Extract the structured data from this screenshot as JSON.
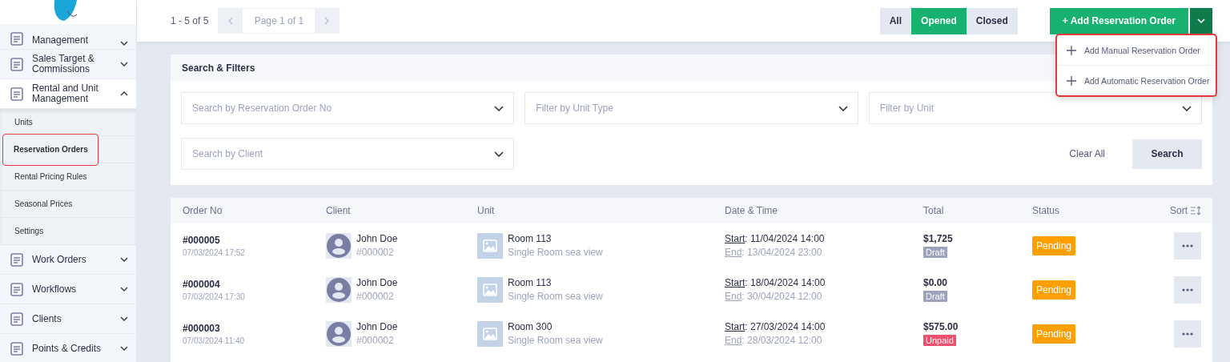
{
  "sidebar": {
    "items": [
      {
        "label": "Management",
        "expanded": false
      },
      {
        "label": "Sales Target & Commissions",
        "expanded": false
      },
      {
        "label": "Rental and Unit Management",
        "expanded": true,
        "children": [
          {
            "label": "Units",
            "selected": false,
            "highlighted": false
          },
          {
            "label": "Reservation Orders",
            "selected": true,
            "highlighted": true
          },
          {
            "label": "Rental Pricing Rules",
            "selected": false,
            "highlighted": false
          },
          {
            "label": "Seasonal Prices",
            "selected": false,
            "highlighted": false
          },
          {
            "label": "Settings",
            "selected": false,
            "highlighted": false
          }
        ]
      },
      {
        "label": "Work Orders",
        "expanded": false
      },
      {
        "label": "Workflows",
        "expanded": false
      },
      {
        "label": "Clients",
        "expanded": false
      },
      {
        "label": "Points & Credits",
        "expanded": false
      }
    ]
  },
  "toolbar": {
    "count": "1 - 5 of 5",
    "page": "Page 1 of 1",
    "filters": [
      {
        "label": "All",
        "selected": false
      },
      {
        "label": "Opened",
        "selected": true
      },
      {
        "label": "Closed",
        "selected": false
      }
    ],
    "add_button": "+ Add Reservation Order",
    "add_menu": {
      "open": true,
      "highlighted": true,
      "items": [
        "Add Manual Reservation Order",
        "Add Automatic Reservation Order"
      ]
    }
  },
  "filters": {
    "title": "Search & Filters",
    "fields": [
      {
        "placeholder": "Search by Reservation Order No"
      },
      {
        "placeholder": "Filter by Unit Type"
      },
      {
        "placeholder": "Filter by Unit"
      },
      {
        "placeholder": "Search by Client"
      }
    ],
    "clear": "Clear All",
    "search": "Search"
  },
  "table": {
    "columns": [
      "Order No",
      "Client",
      "Unit",
      "Date & Time",
      "Total",
      "Status",
      "Sort"
    ],
    "rows": [
      {
        "order": "#000005",
        "created": "07/03/2024 17:52",
        "client": "John Doe",
        "client_no": "#000002",
        "unit": "Room 113",
        "unit_type": "Single Room sea view",
        "start_label": "Start",
        "start": ": 11/04/2024 14:00",
        "end_label": "End",
        "end": ": 13/04/2024 23:00",
        "total": "$1,725",
        "payment": {
          "kind": "draft",
          "label": "Draft"
        },
        "status": {
          "kind": "pending",
          "label": "Pending"
        }
      },
      {
        "order": "#000004",
        "created": "07/03/2024 17:30",
        "client": "John Doe",
        "client_no": "#000002",
        "unit": "Room 113",
        "unit_type": "Single Room sea view",
        "start_label": "Start",
        "start": ": 18/04/2024 14:00",
        "end_label": "End",
        "end": ": 30/04/2024 12:00",
        "total": "$0.00",
        "payment": {
          "kind": "draft",
          "label": "Draft"
        },
        "status": {
          "kind": "pending",
          "label": "Pending"
        }
      },
      {
        "order": "#000003",
        "created": "07/03/2024 11:40",
        "client": "John Doe",
        "client_no": "#000002",
        "unit": "Room 300",
        "unit_type": "Single Room sea view",
        "start_label": "Start",
        "start": ": 27/03/2024 14:00",
        "end_label": "End",
        "end": ": 28/03/2024 12:00",
        "total": "$575.00",
        "payment": {
          "kind": "unpaid",
          "label": "Unpaid"
        },
        "status": {
          "kind": "pending",
          "label": "Pending"
        }
      }
    ]
  }
}
